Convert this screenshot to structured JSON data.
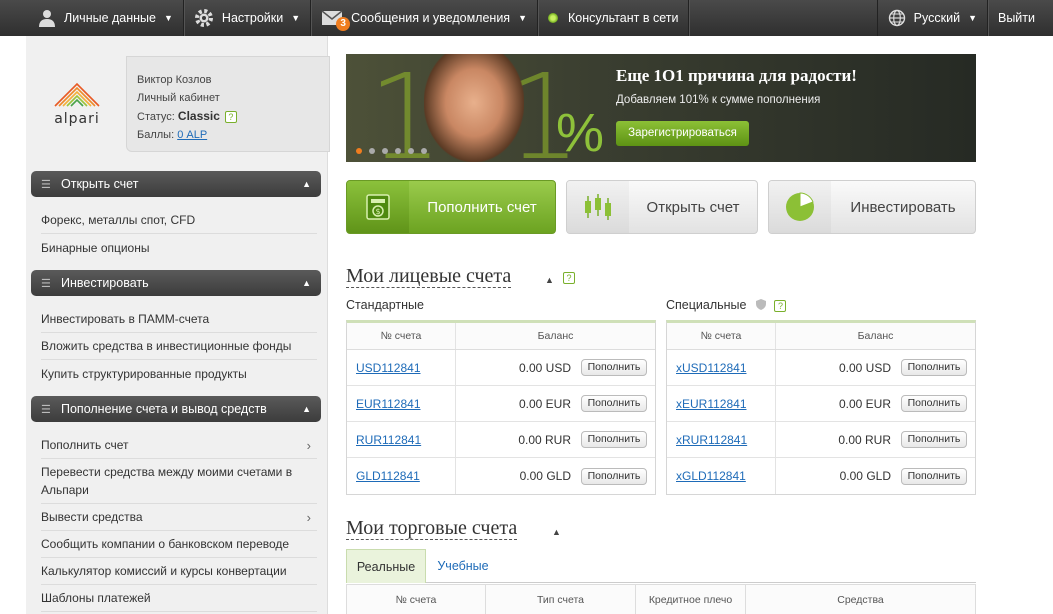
{
  "topbar": {
    "personal": "Личные данные",
    "settings": "Настройки",
    "messages": "Сообщения и уведомления",
    "messages_count": "3",
    "consultant": "Консультант в сети",
    "language": "Русский",
    "logout": "Выйти"
  },
  "profile": {
    "name": "Виктор Козлов",
    "cabinet_label": "Личный кабинет",
    "status_label": "Статус:",
    "status_value": "Classic",
    "points_label": "Баллы:",
    "points_value": "0 ALP",
    "logo_text": "alpari"
  },
  "sidebar": {
    "sections": [
      {
        "title": "Открыть счет",
        "items": [
          "Форекс, металлы спот, CFD",
          "Бинарные опционы"
        ]
      },
      {
        "title": "Инвестировать",
        "items": [
          "Инвестировать в ПАММ-счета",
          "Вложить средства в инвестиционные фонды",
          "Купить структурированные продукты"
        ]
      },
      {
        "title": "Пополнение счета и вывод средств",
        "items": [
          "Пополнить счет",
          "Перевести средства между моими счетами в Альпари",
          "Вывести средства",
          "Сообщить компании о банковском переводе",
          "Калькулятор комиссий и курсы конвертации",
          "Шаблоны платежей"
        ]
      }
    ]
  },
  "banner": {
    "big": "101",
    "percent": "%",
    "title": "Еще 1О1 причина для радости!",
    "subtitle": "Добавляем 101% к сумме пополнения",
    "button": "Зарегистрироваться"
  },
  "actions": {
    "deposit": "Пополнить счет",
    "open": "Открыть счет",
    "invest": "Инвестировать"
  },
  "personal_accounts": {
    "title": "Мои лицевые счета",
    "standard_label": "Стандартные",
    "special_label": "Специальные",
    "col_number": "№ счета",
    "col_balance": "Баланс",
    "topup_label": "Пополнить",
    "standard": [
      {
        "number": "USD112841",
        "balance": "0.00 USD"
      },
      {
        "number": "EUR112841",
        "balance": "0.00 EUR"
      },
      {
        "number": "RUR112841",
        "balance": "0.00 RUR"
      },
      {
        "number": "GLD112841",
        "balance": "0.00 GLD"
      }
    ],
    "special": [
      {
        "number": "xUSD112841",
        "balance": "0.00 USD"
      },
      {
        "number": "xEUR112841",
        "balance": "0.00 EUR"
      },
      {
        "number": "xRUR112841",
        "balance": "0.00 RUR"
      },
      {
        "number": "xGLD112841",
        "balance": "0.00 GLD"
      }
    ]
  },
  "trading_accounts": {
    "title": "Мои торговые счета",
    "tab_real": "Реальные",
    "tab_demo": "Учебные",
    "col_number": "№ счета",
    "col_type": "Тип счета",
    "col_leverage": "Кредитное плечо",
    "col_funds": "Средства"
  },
  "icons": {
    "user": "user-icon",
    "settings": "gear-icon",
    "mail": "envelope-icon",
    "globe": "globe-icon"
  }
}
